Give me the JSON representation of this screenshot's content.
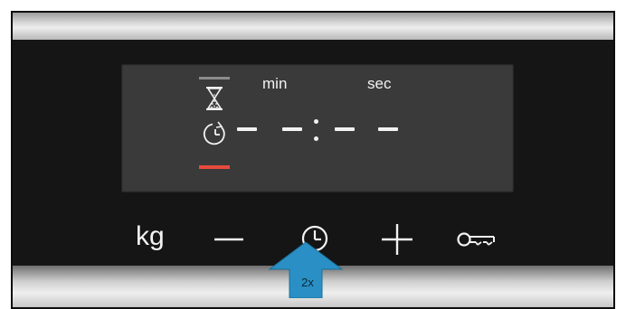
{
  "display": {
    "unit_min": "min",
    "unit_sec": "sec",
    "indicator_top_color": "#8c8c8c",
    "indicator_active_color": "#e64a3c",
    "icons": [
      "hourglass-icon",
      "timer-clock-icon"
    ]
  },
  "keys": {
    "weight_label": "kg",
    "minus_icon": "minus-icon",
    "clock_icon": "clock-icon",
    "plus_icon": "plus-icon",
    "lock_icon": "key-lock-icon"
  },
  "callout": {
    "label": "2x",
    "color": "#2a8fc4"
  }
}
